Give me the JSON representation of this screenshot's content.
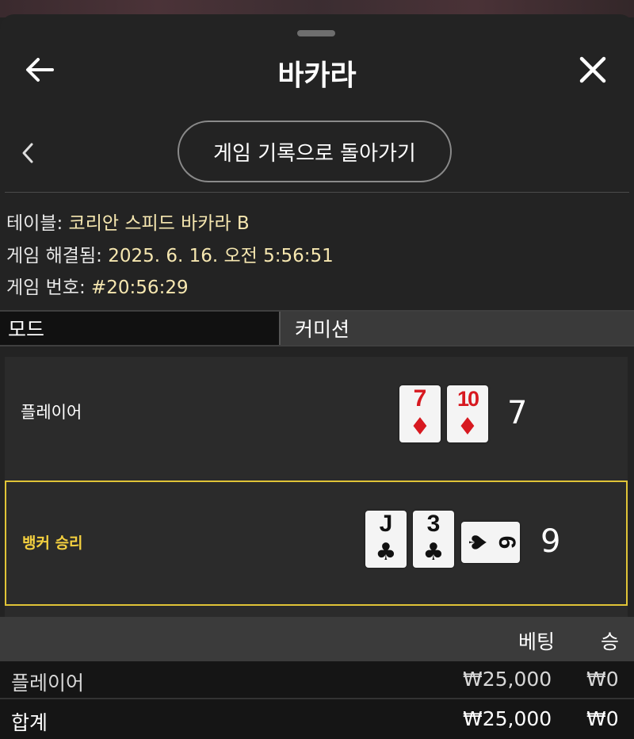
{
  "header": {
    "title": "바카라",
    "back_icon": "back-arrow-icon",
    "close_icon": "close-icon"
  },
  "nav": {
    "prev_icon": "chevron-left-icon",
    "history_button": "게임 기록으로 돌아가기"
  },
  "info": {
    "table_label": "테이블:",
    "table_value": "코리안 스피드 바카라 B",
    "resolved_label": "게임 해결됨:",
    "resolved_value": "2025. 6. 16. 오전 5:56:51",
    "game_no_label": "게임 번호:",
    "game_no_value": "#20:56:29"
  },
  "mode": {
    "label": "모드",
    "value": "커미션"
  },
  "result": {
    "player": {
      "label": "플레이어",
      "score": "7",
      "cards": [
        {
          "rank": "7",
          "suit": "♦",
          "color": "#d71920"
        },
        {
          "rank": "10",
          "suit": "♦",
          "color": "#d71920"
        }
      ]
    },
    "banker": {
      "label": "뱅커 승리",
      "score": "9",
      "highlight_color": "#e0c437",
      "cards": [
        {
          "rank": "J",
          "suit": "♣",
          "color": "#111111"
        },
        {
          "rank": "3",
          "suit": "♣",
          "color": "#111111"
        },
        {
          "rank": "6",
          "suit": "♠",
          "color": "#111111",
          "sideways": true
        }
      ]
    }
  },
  "bets": {
    "columns": [
      "",
      "베팅",
      "승"
    ],
    "rows": [
      {
        "name": "플레이어",
        "bet": "₩25,000",
        "win": "₩0"
      }
    ],
    "total": {
      "name": "합계",
      "bet": "₩25,000",
      "win": "₩0"
    }
  }
}
